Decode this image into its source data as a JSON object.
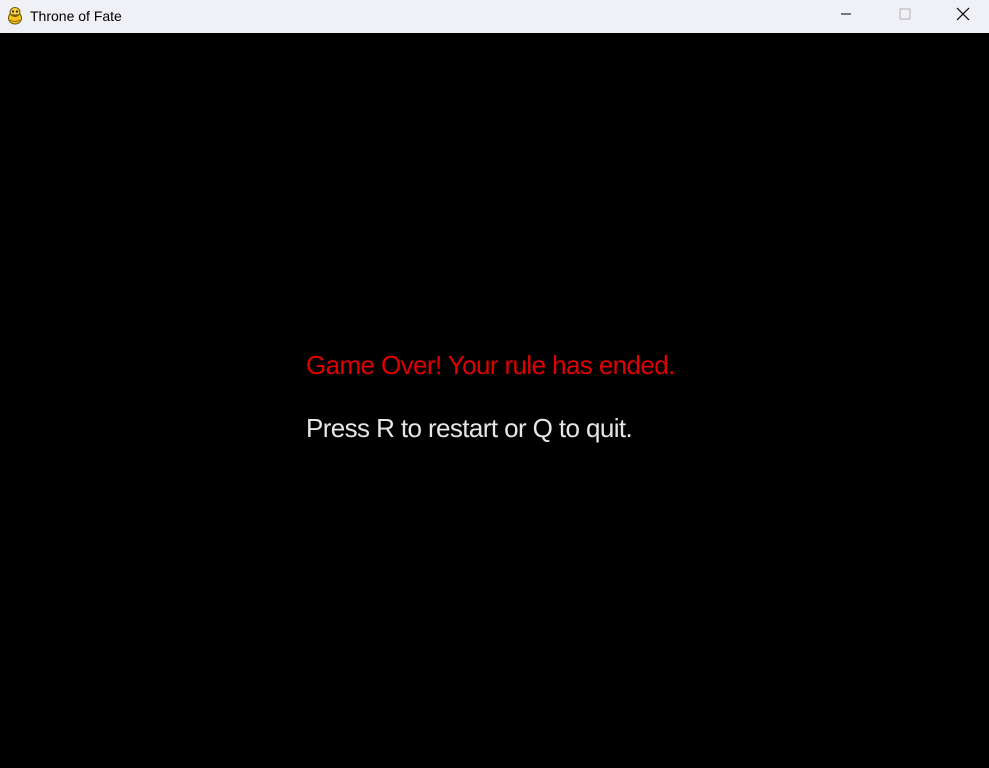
{
  "window": {
    "title": "Throne of Fate",
    "icon": "pygame-snake-icon",
    "controls": {
      "minimize_icon": "minimize-icon",
      "maximize_icon": "maximize-icon",
      "close_icon": "close-icon"
    }
  },
  "game": {
    "background_color": "#000000",
    "game_over_text": "Game Over! Your rule has ended.",
    "game_over_color": "#e00000",
    "instructions_text": "Press R to restart or Q to quit.",
    "instructions_color": "#e6e6e6"
  }
}
